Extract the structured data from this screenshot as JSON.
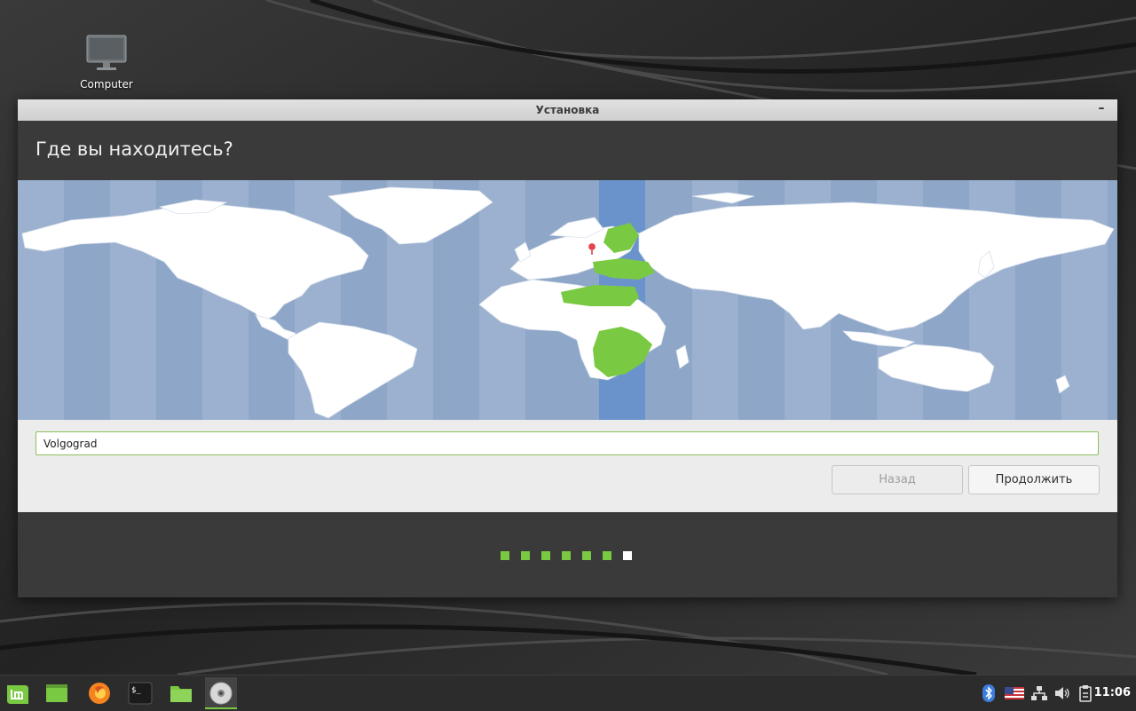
{
  "desktop": {
    "icon_label": "Computer"
  },
  "window": {
    "title": "Установка",
    "minimize_glyph": "–",
    "heading": "Где вы находитесь?",
    "location_value": "Volgograd",
    "back_label": "Назад",
    "continue_label": "Продолжить",
    "progress": {
      "total": 7,
      "current": 7
    },
    "colors": {
      "accent": "#7ac943",
      "map_water": "#8ea6c7",
      "selected_timezone": "#6a93cc",
      "header_band": "#3a3a3a"
    }
  },
  "taskbar": {
    "launchers": [
      "mint-menu-icon",
      "show-desktop-icon",
      "firefox-icon",
      "terminal-icon",
      "files-icon",
      "installer-disc-icon"
    ],
    "tray_icons": [
      "bluetooth-icon",
      "us-flag-keyboard-icon",
      "network-icon",
      "volume-icon",
      "clipboard-icon"
    ],
    "clock": "11:06"
  }
}
